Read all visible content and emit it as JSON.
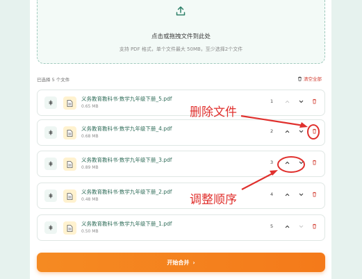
{
  "dropzone": {
    "title": "点击或拖拽文件到此处",
    "subtitle": "支持 PDF 格式，单个文件最大 50MB，至少选择2个文件"
  },
  "list_header": {
    "selected_count": "已选择 5 个文件",
    "clear_all": "清空全部"
  },
  "files": [
    {
      "name": "义务教育教科书·数学九年级下册_5.pdf",
      "size": "0.65 MB",
      "order": "1",
      "up_enabled": false,
      "down_enabled": true
    },
    {
      "name": "义务教育教科书·数学九年级下册_4.pdf",
      "size": "0.68 MB",
      "order": "2",
      "up_enabled": true,
      "down_enabled": true
    },
    {
      "name": "义务教育教科书·数学九年级下册_3.pdf",
      "size": "0.89 MB",
      "order": "3",
      "up_enabled": true,
      "down_enabled": true
    },
    {
      "name": "义务教育教科书·数学九年级下册_2.pdf",
      "size": "0.48 MB",
      "order": "4",
      "up_enabled": true,
      "down_enabled": true
    },
    {
      "name": "义务教育教科书·数学九年级下册_1.pdf",
      "size": "0.50 MB",
      "order": "5",
      "up_enabled": true,
      "down_enabled": false
    }
  ],
  "merge_button": {
    "label": "开始合并",
    "arrow": "›"
  },
  "annotations": {
    "delete_label": "删除文件",
    "reorder_label": "调整顺序"
  },
  "colors": {
    "accent": "#2d6b57",
    "merge_button": "#f47a1a",
    "annotation": "#e0302d",
    "delete": "#d23b2f"
  }
}
